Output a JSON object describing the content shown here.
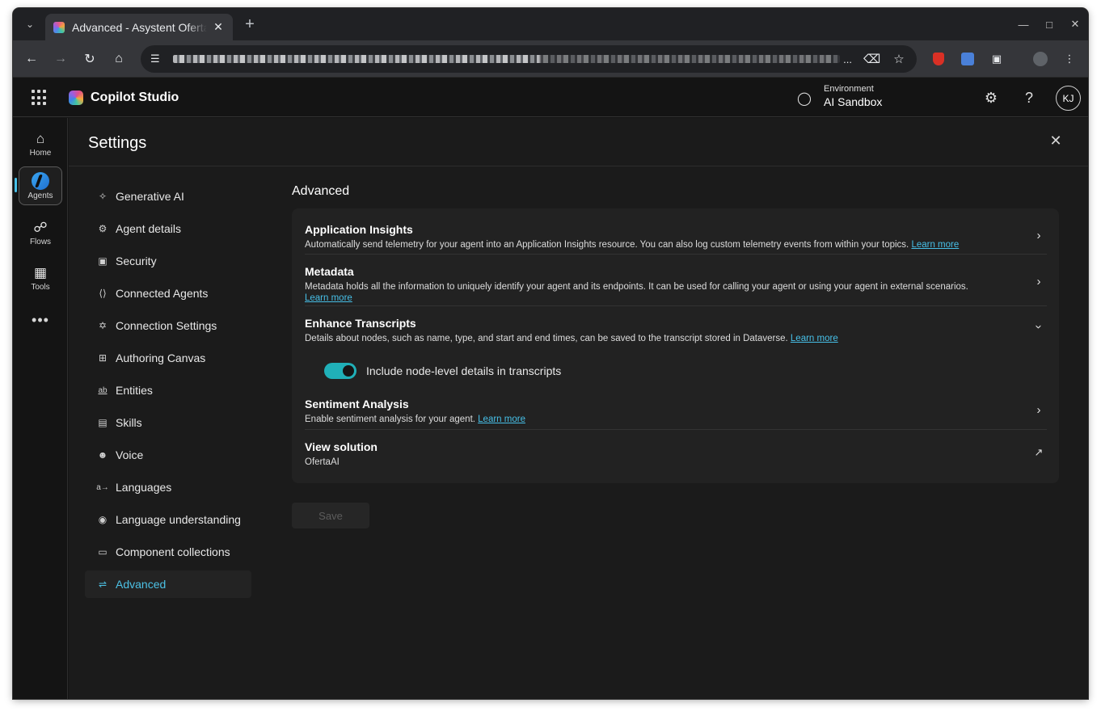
{
  "browser": {
    "tab_title": "Advanced - Asystent Oferta",
    "tab_close": "✕",
    "new_tab": "+",
    "omnibox_ellipsis": "..."
  },
  "app": {
    "name": "Copilot Studio",
    "environment_label": "Environment",
    "environment_value": "AI Sandbox",
    "help": "?",
    "avatar_initials": "KJ"
  },
  "rail": {
    "items": [
      {
        "label": "Home",
        "icon": "home-icon"
      },
      {
        "label": "Agents",
        "icon": "agents-icon"
      },
      {
        "label": "Flows",
        "icon": "flows-icon"
      },
      {
        "label": "Tools",
        "icon": "tools-icon"
      }
    ],
    "more": "•••"
  },
  "settings": {
    "title": "Settings",
    "nav": [
      {
        "label": "Generative AI",
        "icon": "sparkle-icon"
      },
      {
        "label": "Agent details",
        "icon": "gear-icon"
      },
      {
        "label": "Security",
        "icon": "lock-icon"
      },
      {
        "label": "Connected Agents",
        "icon": "code-icon"
      },
      {
        "label": "Connection Settings",
        "icon": "connection-icon"
      },
      {
        "label": "Authoring Canvas",
        "icon": "grid-icon"
      },
      {
        "label": "Entities",
        "icon": "entities-icon"
      },
      {
        "label": "Skills",
        "icon": "briefcase-icon"
      },
      {
        "label": "Voice",
        "icon": "voice-icon"
      },
      {
        "label": "Languages",
        "icon": "translate-icon"
      },
      {
        "label": "Language understanding",
        "icon": "globe-icon"
      },
      {
        "label": "Component collections",
        "icon": "collection-icon"
      },
      {
        "label": "Advanced",
        "icon": "sliders-icon",
        "active": true
      }
    ],
    "section_title": "Advanced",
    "rows": {
      "app_insights": {
        "title": "Application Insights",
        "desc": "Automatically send telemetry for your agent into an Application Insights resource. You can also log custom telemetry events from within your topics.",
        "link": "Learn more"
      },
      "metadata": {
        "title": "Metadata",
        "desc": "Metadata holds all the information to uniquely identify your agent and its endpoints. It can be used for calling your agent or using your agent in external scenarios.",
        "link": "Learn more"
      },
      "enhance": {
        "title": "Enhance Transcripts",
        "desc": "Details about nodes, such as name, type, and start and end times, can be saved to the transcript stored in Dataverse.",
        "link": "Learn more",
        "toggle_label": "Include node-level details in transcripts",
        "toggle_on": true
      },
      "sentiment": {
        "title": "Sentiment Analysis",
        "desc": "Enable sentiment analysis for your agent.",
        "link": "Learn more"
      },
      "solution": {
        "title": "View solution",
        "value": "OfertaAI"
      }
    },
    "save_label": "Save"
  },
  "colors": {
    "accent": "#4cc2e6",
    "toggle": "#20b0b8",
    "background": "#1b1b1b"
  }
}
